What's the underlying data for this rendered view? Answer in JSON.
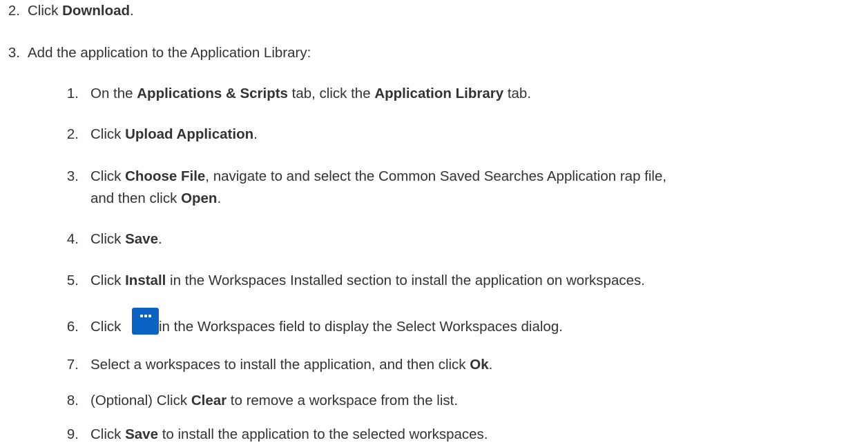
{
  "outer": [
    {
      "number": "2.",
      "parts": [
        {
          "t": "Click "
        },
        {
          "t": "Download",
          "b": true
        },
        {
          "t": "."
        }
      ]
    },
    {
      "number": "3.",
      "parts": [
        {
          "t": "Add the application to the Application Library:"
        }
      ]
    }
  ],
  "sub": [
    {
      "number": "1.",
      "parts": [
        {
          "t": "On the "
        },
        {
          "t": "Applications & Scripts",
          "b": true
        },
        {
          "t": " tab, click the "
        },
        {
          "t": "Application Library",
          "b": true
        },
        {
          "t": " tab."
        }
      ]
    },
    {
      "number": "2.",
      "parts": [
        {
          "t": "Click "
        },
        {
          "t": "Upload Application",
          "b": true
        },
        {
          "t": "."
        }
      ]
    },
    {
      "number": "3.",
      "parts": [
        {
          "t": "Click "
        },
        {
          "t": "Choose File",
          "b": true
        },
        {
          "t": ", navigate to and select the Common Saved Searches Application rap file,"
        }
      ]
    },
    {
      "number": "",
      "parts": [
        {
          "t": "and then click "
        },
        {
          "t": "Open",
          "b": true
        },
        {
          "t": "."
        }
      ]
    },
    {
      "number": "4.",
      "parts": [
        {
          "t": "Click "
        },
        {
          "t": "Save",
          "b": true
        },
        {
          "t": "."
        }
      ]
    },
    {
      "number": "5.",
      "parts": [
        {
          "t": "Click "
        },
        {
          "t": "Install",
          "b": true
        },
        {
          "t": " in the Workspaces Installed section to install the application on workspaces."
        }
      ]
    },
    {
      "number": "6.",
      "parts": [
        {
          "t": "Click "
        },
        {
          "t": "",
          "icon": "ellipsis-button-icon"
        },
        {
          "t": " in the Workspaces field to display the Select Workspaces dialog."
        }
      ]
    },
    {
      "number": "7.",
      "parts": [
        {
          "t": "Select a workspaces to install the application, and then click "
        },
        {
          "t": "Ok",
          "b": true
        },
        {
          "t": "."
        }
      ]
    },
    {
      "number": "8.",
      "parts": [
        {
          "t": "(Optional) Click "
        },
        {
          "t": "Clear",
          "b": true
        },
        {
          "t": " to remove a workspace from the list."
        }
      ]
    },
    {
      "number": "9.",
      "parts": [
        {
          "t": "Click "
        },
        {
          "t": "Save",
          "b": true
        },
        {
          "t": " to install the application to the selected workspaces."
        }
      ]
    }
  ],
  "colors": {
    "text": "#333333",
    "button": "#0a63c2"
  }
}
